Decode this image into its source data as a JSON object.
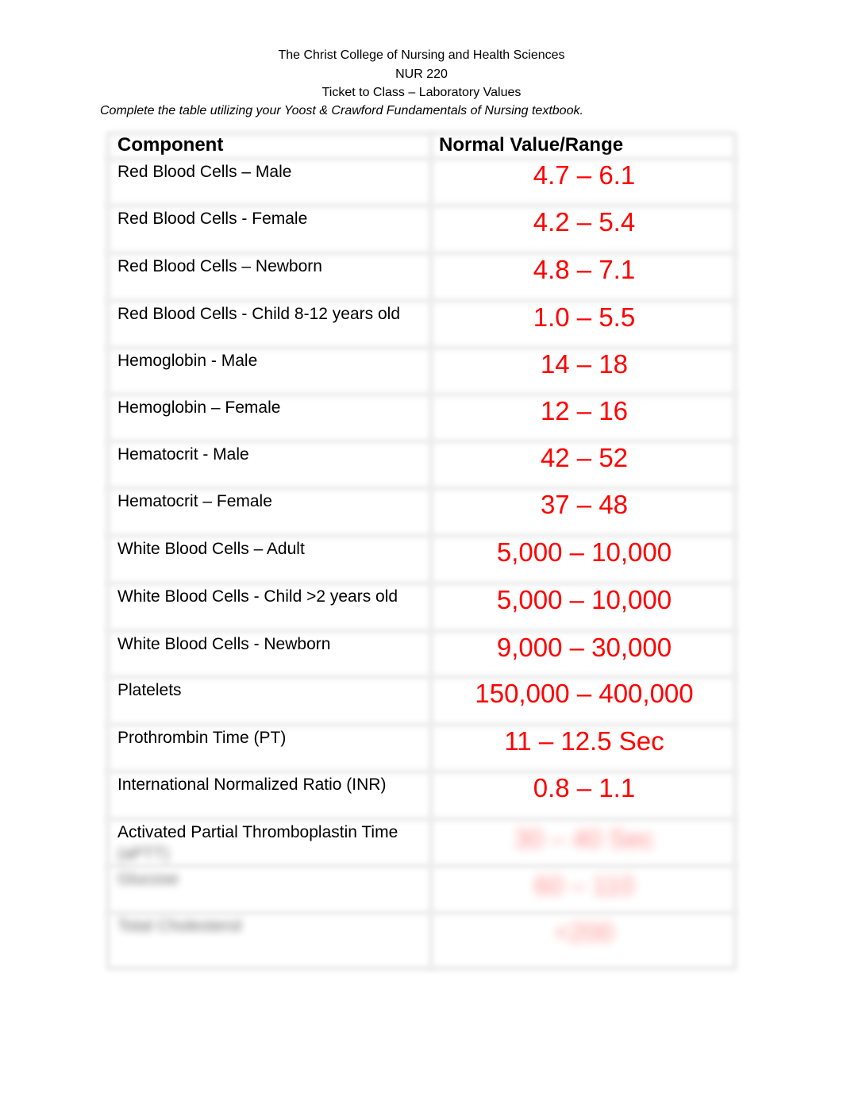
{
  "document": {
    "institution": "The Christ College of Nursing and Health Sciences",
    "course": "NUR 220",
    "title": "Ticket to Class – Laboratory Values",
    "instructions": "Complete the table utilizing your Yoost & Crawford Fundamentals of Nursing textbook."
  },
  "table": {
    "headers": {
      "component": "Component",
      "value": "Normal Value/Range"
    },
    "rows": [
      {
        "component": "Red Blood Cells – Male",
        "value": "4.7 – 6.1"
      },
      {
        "component": "Red Blood Cells - Female",
        "value": "4.2 – 5.4"
      },
      {
        "component": "Red Blood Cells – Newborn",
        "value": "4.8 – 7.1"
      },
      {
        "component": "Red Blood Cells - Child 8-12 years old",
        "value": "1.0 – 5.5"
      },
      {
        "component": "Hemoglobin - Male",
        "value": "14 – 18"
      },
      {
        "component": "Hemoglobin – Female",
        "value": "12 – 16"
      },
      {
        "component": "Hematocrit - Male",
        "value": "42 – 52"
      },
      {
        "component": "Hematocrit – Female",
        "value": "37 – 48"
      },
      {
        "component": "White Blood Cells – Adult",
        "value": "5,000 – 10,000"
      },
      {
        "component": "White Blood Cells - Child >2 years old",
        "value": "5,000 – 10,000"
      },
      {
        "component": "White Blood Cells - Newborn",
        "value": "9,000 – 30,000"
      },
      {
        "component": "Platelets",
        "value": "150,000 – 400,000"
      },
      {
        "component": "Prothrombin Time (PT)",
        "value": "11 – 12.5 Sec"
      },
      {
        "component": "International Normalized Ratio (INR)",
        "value": "0.8 – 1.1"
      },
      {
        "component": "Activated Partial Thromboplastin Time",
        "component_line2": "(aPTT)",
        "value": "30 – 40 Sec"
      },
      {
        "component": "Glucose",
        "value": "60 – 110"
      },
      {
        "component": "Total Cholesterol",
        "value": "<200"
      }
    ]
  }
}
